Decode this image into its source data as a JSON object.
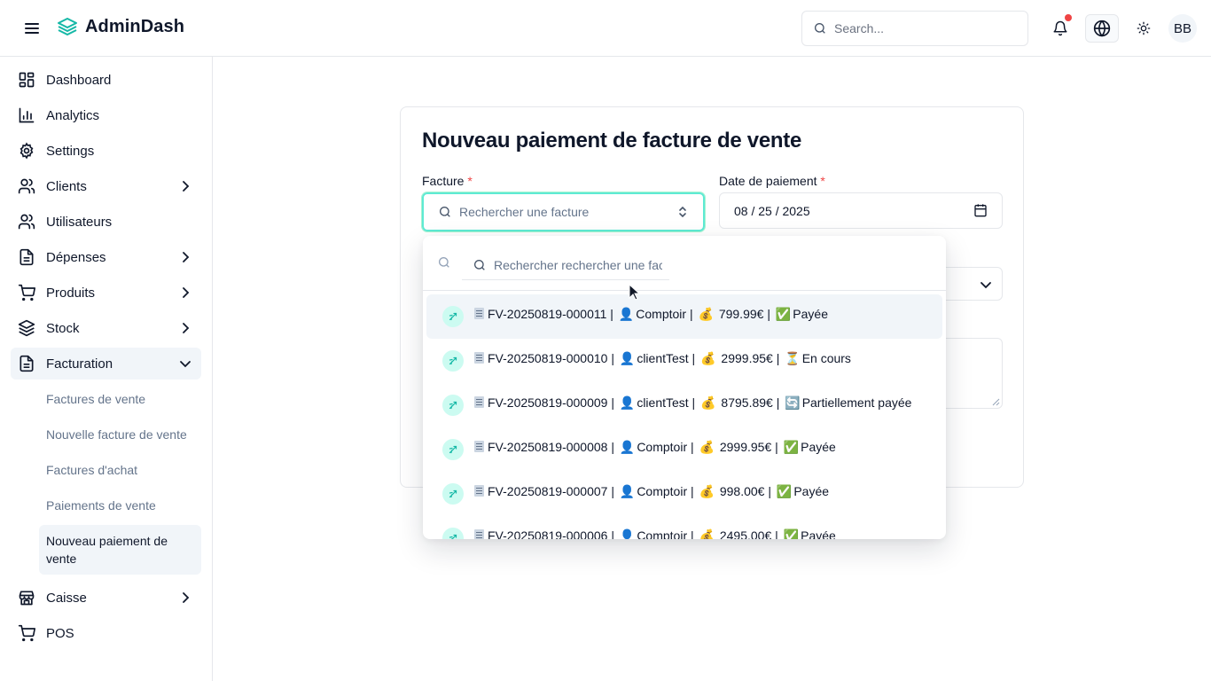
{
  "app": {
    "brand": "AdminDash",
    "search_placeholder": "Search...",
    "avatar_initials": "BB",
    "accent_color": "#14b8a6"
  },
  "sidebar": {
    "items": [
      {
        "label": "Dashboard",
        "icon": "dashboard-icon"
      },
      {
        "label": "Analytics",
        "icon": "bar-chart-icon"
      },
      {
        "label": "Settings",
        "icon": "gear-icon"
      },
      {
        "label": "Clients",
        "icon": "users-icon",
        "has_children": true
      },
      {
        "label": "Utilisateurs",
        "icon": "users-icon"
      },
      {
        "label": "Dépenses",
        "icon": "file-text-icon",
        "has_children": true
      },
      {
        "label": "Produits",
        "icon": "cart-icon",
        "has_children": true
      },
      {
        "label": "Stock",
        "icon": "layers-icon",
        "has_children": true
      },
      {
        "label": "Facturation",
        "icon": "file-text-icon",
        "has_children": true,
        "expanded": true
      },
      {
        "label": "Caisse",
        "icon": "store-icon",
        "has_children": true
      },
      {
        "label": "POS",
        "icon": "cart-icon"
      }
    ],
    "facturation_children": [
      "Factures de vente",
      "Nouvelle facture de vente",
      "Factures d'achat",
      "Paiements de vente",
      "Nouveau paiement de vente"
    ],
    "active_child": "Nouveau paiement de vente"
  },
  "form": {
    "title": "Nouveau paiement de facture de vente",
    "facture_label": "Facture",
    "facture_placeholder": "Rechercher une facture",
    "date_label": "Date de paiement",
    "date_value": "08 / 25 / 2025",
    "required_mark": "*"
  },
  "dropdown": {
    "search_placeholder": "Rechercher rechercher une facture",
    "options": [
      {
        "number": "FV-20250819-000011",
        "client": "Comptoir",
        "amount": "799.99€",
        "status_emoji": "✅",
        "status": "Payée"
      },
      {
        "number": "FV-20250819-000010",
        "client": "clientTest",
        "amount": "2999.95€",
        "status_emoji": "⏳",
        "status": "En cours"
      },
      {
        "number": "FV-20250819-000009",
        "client": "clientTest",
        "amount": "8795.89€",
        "status_emoji": "🔄",
        "status": "Partiellement payée"
      },
      {
        "number": "FV-20250819-000008",
        "client": "Comptoir",
        "amount": "2999.95€",
        "status_emoji": "✅",
        "status": "Payée"
      },
      {
        "number": "FV-20250819-000007",
        "client": "Comptoir",
        "amount": "998.00€",
        "status_emoji": "✅",
        "status": "Payée"
      },
      {
        "number": "FV-20250819-000006",
        "client": "Comptoir",
        "amount": "2495.00€",
        "status_emoji": "✅",
        "status": "Payée"
      }
    ],
    "highlighted_index": 0
  }
}
